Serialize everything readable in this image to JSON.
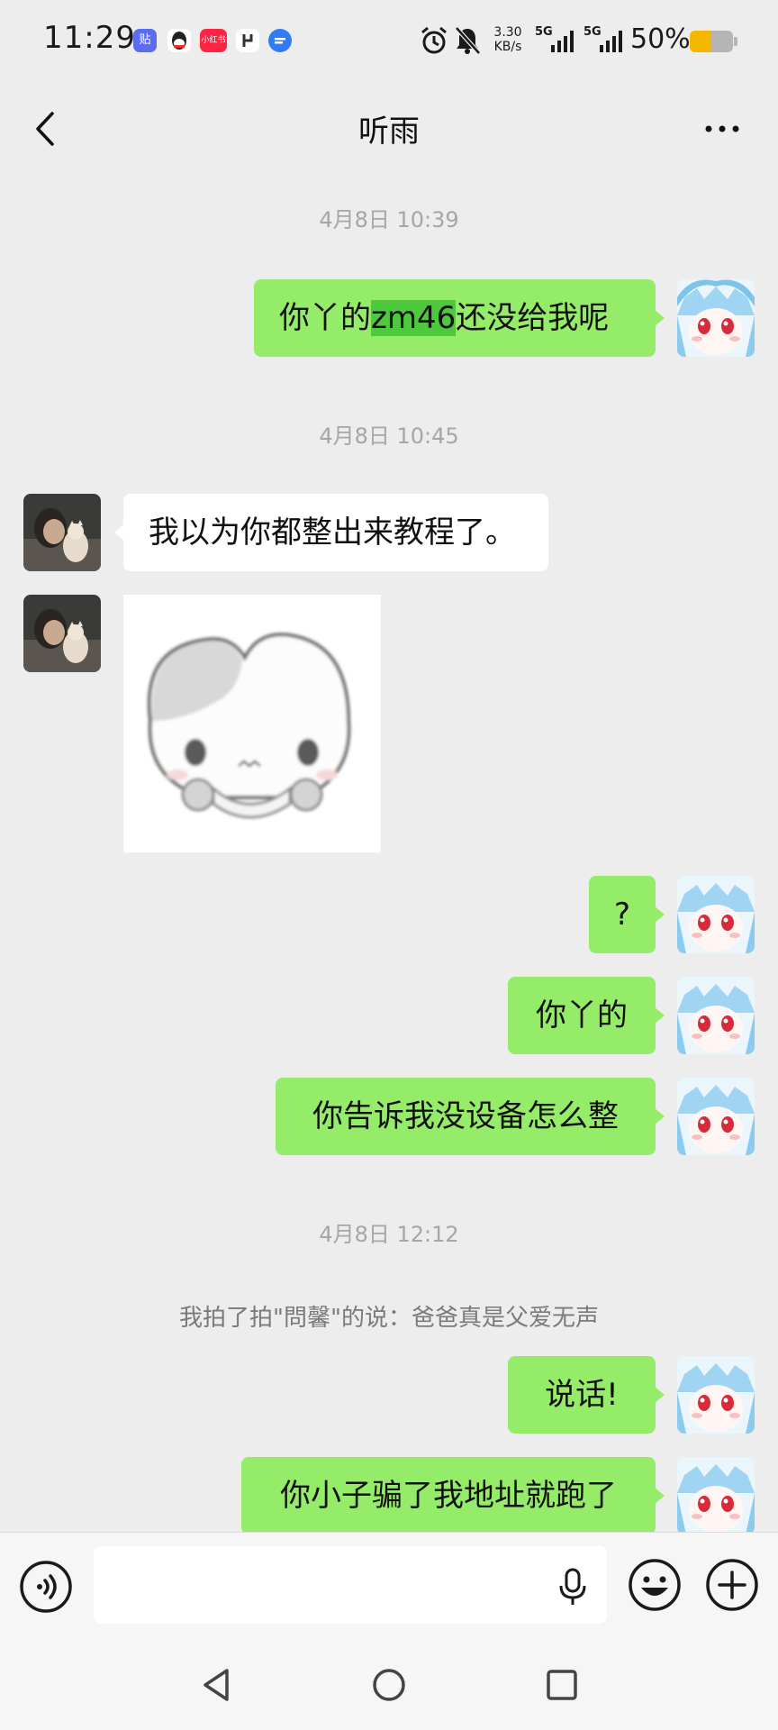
{
  "status_bar": {
    "time": "11:29",
    "app_icons": [
      {
        "name": "tieba-icon",
        "label": "贴",
        "color": "#5a6cf0"
      },
      {
        "name": "qq-icon",
        "label": "",
        "color": "#222222"
      },
      {
        "name": "xiaohongshu-icon",
        "label": "小红书",
        "color": "#ff2442"
      },
      {
        "name": "douyin-icon",
        "label": "",
        "color": "#333333"
      },
      {
        "name": "message-icon",
        "label": "",
        "color": "#2f7cf6"
      }
    ],
    "net_speed_top": "3.30",
    "net_speed_bottom": "KB/s",
    "sim1_label": "5G",
    "sim2_label": "5G",
    "battery_text": "50%",
    "battery_level": 0.5,
    "battery_color": "#f5b800"
  },
  "header": {
    "title": "听雨"
  },
  "messages": {
    "ts1": "4月8日 10:39",
    "m1_pre": "你丫的",
    "m1_hl": "zm46",
    "m1_post": "还没给我呢",
    "ts2": "4月8日 10:45",
    "m2": "我以为你都整出来教程了。",
    "m4": "?",
    "m5": "你丫的",
    "m6": "你告诉我没设备怎么整",
    "ts3": "4月8日 12:12",
    "pat": "我拍了拍\"問馨\"的说：爸爸真是父爱无声",
    "m7": "说话!",
    "m8": "你小子骗了我地址就跑了"
  },
  "colors": {
    "me_bubble": "#95ec69",
    "highlight": "#4ec93d",
    "background": "#ededed"
  }
}
